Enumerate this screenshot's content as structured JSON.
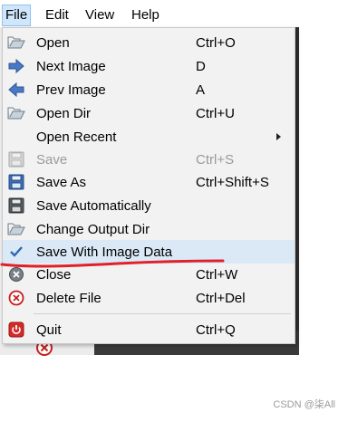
{
  "menubar": {
    "items": [
      "File",
      "Edit",
      "View",
      "Help"
    ]
  },
  "file_menu": {
    "open": {
      "label": "Open",
      "shortcut": "Ctrl+O",
      "icon": "folder-open-icon"
    },
    "next_image": {
      "label": "Next Image",
      "shortcut": "D",
      "icon": "arrow-right-icon"
    },
    "prev_image": {
      "label": "Prev Image",
      "shortcut": "A",
      "icon": "arrow-left-icon"
    },
    "open_dir": {
      "label": "Open Dir",
      "shortcut": "Ctrl+U",
      "icon": "folder-open-icon"
    },
    "open_recent": {
      "label": "Open Recent",
      "shortcut": "",
      "icon": "submenu-arrow-icon"
    },
    "save": {
      "label": "Save",
      "shortcut": "Ctrl+S",
      "icon": "floppy-disk-icon",
      "enabled": false
    },
    "save_as": {
      "label": "Save As",
      "shortcut": "Ctrl+Shift+S",
      "icon": "floppy-disk-icon"
    },
    "save_auto": {
      "label": "Save Automatically",
      "shortcut": "",
      "icon": "floppy-disk-icon"
    },
    "change_dir": {
      "label": "Change Output Dir",
      "shortcut": "",
      "icon": "folder-open-icon"
    },
    "save_with": {
      "label": "Save With Image Data",
      "shortcut": "",
      "icon": "check-icon",
      "checked": true
    },
    "close": {
      "label": "Close",
      "shortcut": "Ctrl+W",
      "icon": "close-circle-icon"
    },
    "delete_file": {
      "label": "Delete File",
      "shortcut": "Ctrl+Del",
      "icon": "close-circle-red-icon"
    },
    "quit": {
      "label": "Quit",
      "shortcut": "Ctrl+Q",
      "icon": "power-icon"
    }
  },
  "annotation": {
    "color": "#e0202a"
  },
  "watermark": "CSDN @柒All"
}
